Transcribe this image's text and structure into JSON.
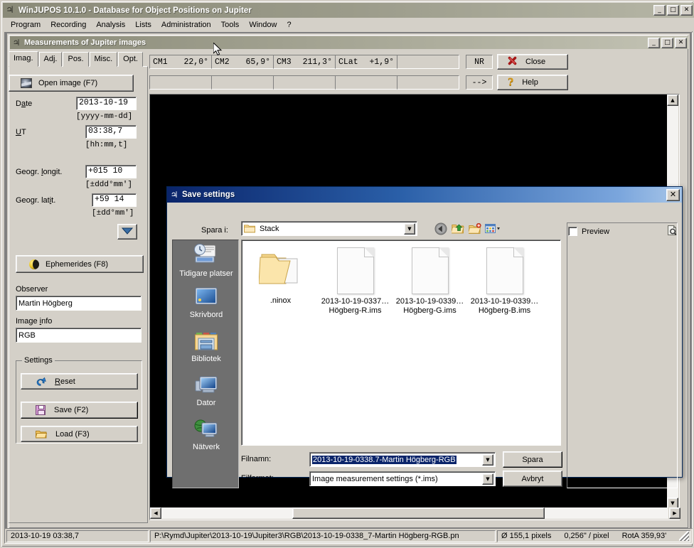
{
  "app": {
    "title": "WinJUPOS 10.1.0 - Database for Object Positions on Jupiter",
    "icon": "jupiter-icon",
    "menu": [
      "Program",
      "Recording",
      "Analysis",
      "Lists",
      "Administration",
      "Tools",
      "Window",
      "?"
    ],
    "window_buttons": {
      "minimize": "_",
      "maximize": "□",
      "close": "✕"
    }
  },
  "child_window": {
    "title": "Measurements of Jupiter images",
    "icon": "jupiter-icon",
    "window_buttons": {
      "minimize": "_",
      "maximize": "□",
      "close": "✕"
    }
  },
  "tabs": [
    {
      "label": "Imag.",
      "active": true
    },
    {
      "label": "Adj.",
      "active": false
    },
    {
      "label": "Pos.",
      "active": false
    },
    {
      "label": "Misc.",
      "active": false
    },
    {
      "label": "Opt.",
      "active": false
    }
  ],
  "info_fields": [
    {
      "name": "CM1",
      "value": "22,0°"
    },
    {
      "name": "CM2",
      "value": "65,9°"
    },
    {
      "name": "CM3",
      "value": "211,3°"
    },
    {
      "name": "CLat",
      "value": "+1,9°"
    }
  ],
  "toolbar": {
    "nr_label": "NR",
    "arrow_label": "-->",
    "close_label": "Close",
    "help_label": "Help"
  },
  "panel": {
    "open_image_label": "Open image (F7)",
    "date_label": "Date",
    "date_value": "2013-10-19",
    "date_hint": "[yyyy-mm-dd]",
    "ut_label": "UT",
    "ut_value": "03:38,7",
    "ut_hint": "[hh:mm,t]",
    "longit_label": "Geogr. longit.",
    "longit_value": "+015 10",
    "longit_hint": "[±ddd°mm']",
    "latit_label": "Geogr. latit.",
    "latit_value": "+59 14",
    "latit_hint": "[±dd°mm']",
    "expand_arrow": "▼",
    "ephemerides_label": "Ephemerides (F8)",
    "observer_label": "Observer",
    "observer_value": "Martin Högberg",
    "image_info_label": "Image info",
    "image_info_value": "RGB",
    "settings_group": "Settings",
    "reset_label": "Reset",
    "save_label": "Save (F2)",
    "load_label": "Load (F3)"
  },
  "dialog": {
    "title": "Save settings",
    "icon": "jupiter-icon",
    "close_label": "✕",
    "save_in_label": "Spara i:",
    "save_in_value": "Stack",
    "toolbar_icons": [
      "back-icon",
      "up-folder-icon",
      "new-folder-icon",
      "views-icon"
    ],
    "places": [
      {
        "label": "Tidigare platser",
        "icon": "recent-places-icon"
      },
      {
        "label": "Skrivbord",
        "icon": "desktop-icon"
      },
      {
        "label": "Bibliotek",
        "icon": "libraries-icon"
      },
      {
        "label": "Dator",
        "icon": "computer-icon"
      },
      {
        "label": "Nätverk",
        "icon": "network-icon"
      }
    ],
    "files": [
      {
        "label_line1": ".ninox",
        "label_line2": "",
        "type": "folder"
      },
      {
        "label_line1": "2013-10-19-0337…",
        "label_line2": "Högberg-R.ims",
        "type": "file"
      },
      {
        "label_line1": "2013-10-19-0339…",
        "label_line2": "Högberg-G.ims",
        "type": "file"
      },
      {
        "label_line1": "2013-10-19-0339…",
        "label_line2": "Högberg-B.ims",
        "type": "file"
      }
    ],
    "preview_label": "Preview",
    "preview_icon": "preview-magnifier-icon",
    "filename_label": "Filnamn:",
    "filename_value": "2013-10-19-0338.7-Martin Högberg-RGB",
    "fileformat_label": "Filformat:",
    "fileformat_value": "Image measurement settings (*.ims)",
    "save_button": "Spara",
    "cancel_button": "Avbryt"
  },
  "statusbar": {
    "datetime": "2013-10-19   03:38,7",
    "path": "P:\\Rymd\\Jupiter\\2013-10-19\\Jupiter3\\RGB\\2013-10-19-0338_7-Martin Högberg-RGB.pn",
    "diameter": "Ø 155,1 pixels",
    "scale": "0,256\" / pixel",
    "rota": "RotA 359,93'"
  }
}
